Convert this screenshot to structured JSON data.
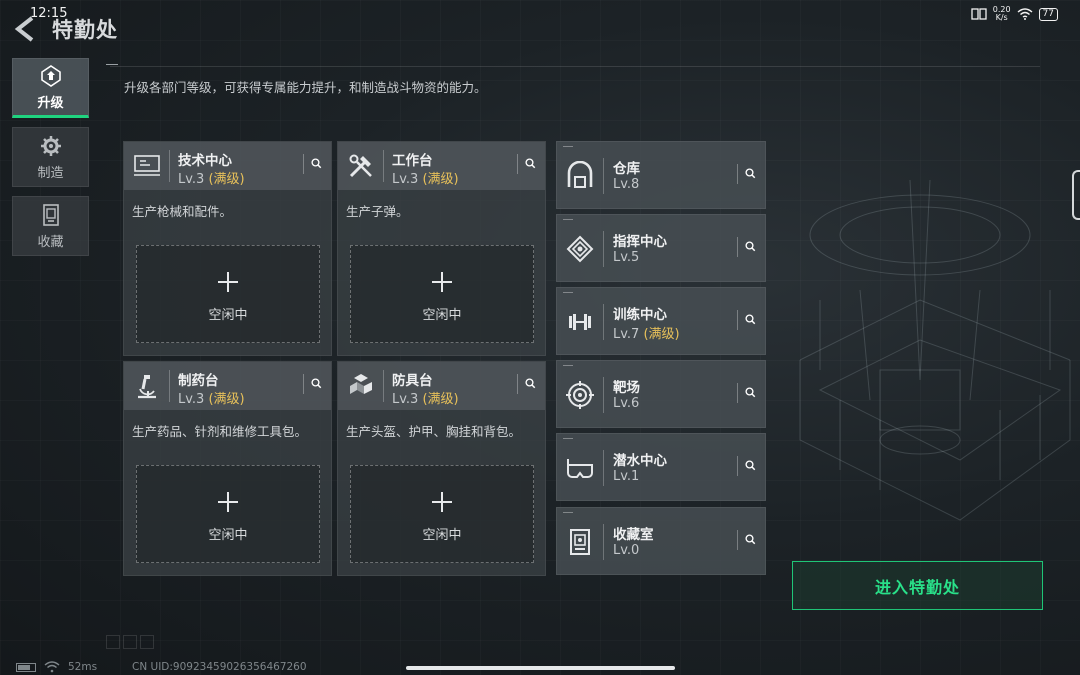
{
  "status_bar": {
    "time": "12:15",
    "net_speed_value": "0.20",
    "net_speed_unit": "K/s",
    "battery": "77",
    "icons": [
      "book-icon",
      "wifi-icon",
      "battery-icon"
    ]
  },
  "header": {
    "back_icon": "chevron-left-icon",
    "title": "特勤处",
    "subtitle": "升级各部门等级，可获得专属能力提升，和制造战斗物资的能力。"
  },
  "tabs": [
    {
      "label": "升级",
      "icon": "upgrade-icon",
      "active": true
    },
    {
      "label": "制造",
      "icon": "gear-icon",
      "active": false
    },
    {
      "label": "收藏",
      "icon": "collection-icon",
      "active": false
    }
  ],
  "departments": [
    {
      "name": "技术中心",
      "level": "Lv.3",
      "maxed_label": "(满级)",
      "desc": "生产枪械和配件。",
      "slot_label": "空闲中",
      "icon": "computer-icon"
    },
    {
      "name": "工作台",
      "level": "Lv.3",
      "maxed_label": "(满级)",
      "desc": "生产子弹。",
      "slot_label": "空闲中",
      "icon": "tools-icon"
    },
    {
      "name": "制药台",
      "level": "Lv.3",
      "maxed_label": "(满级)",
      "desc": "生产药品、针剂和维修工具包。",
      "slot_label": "空闲中",
      "icon": "microscope-icon"
    },
    {
      "name": "防具台",
      "level": "Lv.3",
      "maxed_label": "(满级)",
      "desc": "生产头盔、护甲、胸挂和背包。",
      "slot_label": "空闲中",
      "icon": "boxes-icon"
    }
  ],
  "facilities": [
    {
      "name": "仓库",
      "level": "Lv.8",
      "maxed_label": "",
      "icon": "warehouse-icon"
    },
    {
      "name": "指挥中心",
      "level": "Lv.5",
      "maxed_label": "",
      "icon": "command-icon"
    },
    {
      "name": "训练中心",
      "level": "Lv.7",
      "maxed_label": "(满级)",
      "icon": "dumbbell-icon"
    },
    {
      "name": "靶场",
      "level": "Lv.6",
      "maxed_label": "",
      "icon": "target-icon"
    },
    {
      "name": "潜水中心",
      "level": "Lv.1",
      "maxed_label": "",
      "icon": "diving-mask-icon"
    },
    {
      "name": "收藏室",
      "level": "Lv.0",
      "maxed_label": "",
      "icon": "collection-room-icon"
    }
  ],
  "enter_button": {
    "label": "进入特勤处"
  },
  "footer": {
    "ping": "52ms",
    "uid": "CN UID:9092345902635646726​0"
  },
  "colors": {
    "accent_green": "#29e089",
    "maxed_gold": "#e8c15a",
    "card_bg": "#3a4044",
    "background": "#1c2226"
  }
}
